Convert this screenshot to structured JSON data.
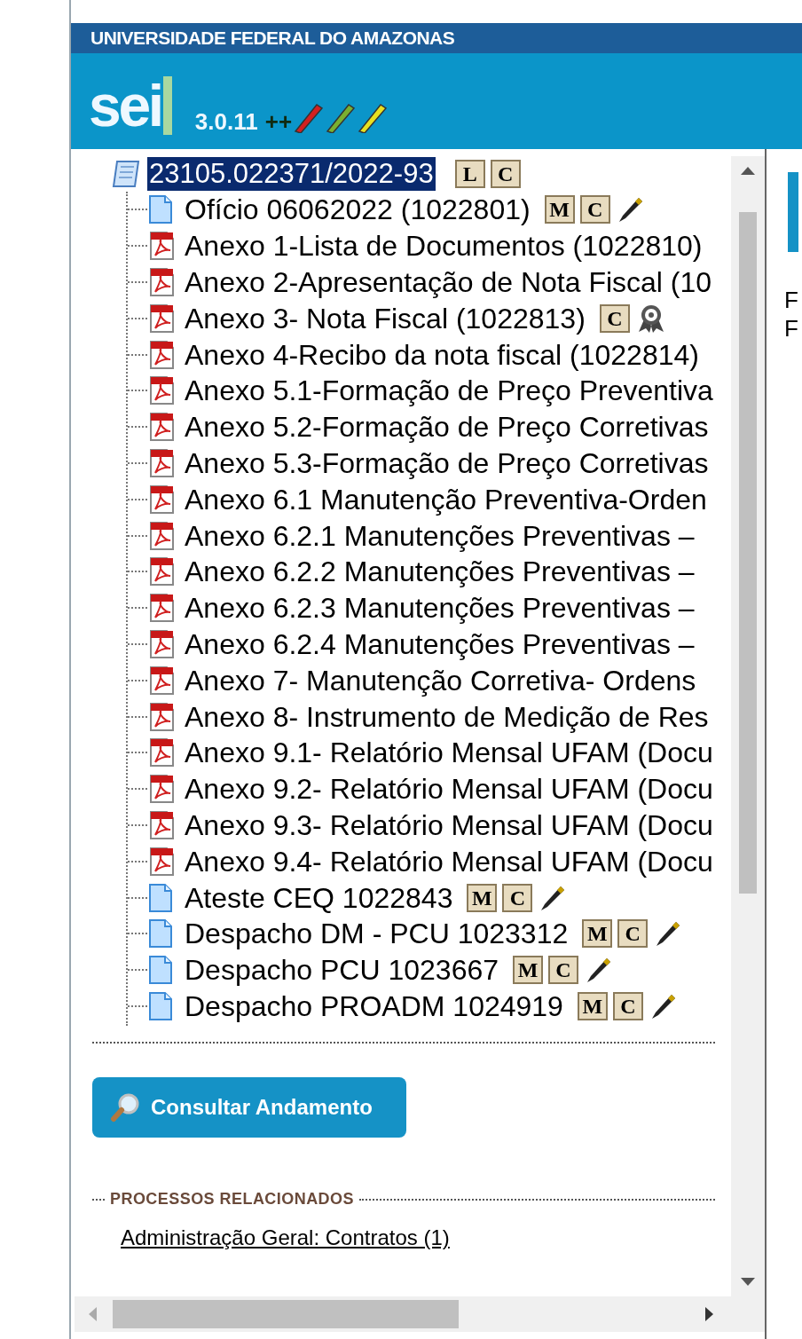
{
  "header": {
    "institution": "UNIVERSIDADE FEDERAL DO AMAZONAS",
    "logo": "sei",
    "version": "3.0.11",
    "version_suffix": "++"
  },
  "tree": {
    "root": {
      "label": "23105.022371/2022-93",
      "selected": true,
      "badges": [
        "L",
        "C"
      ]
    },
    "items": [
      {
        "kind": "doc",
        "label": "Ofício 06062022 (1022801)",
        "badges": [
          "M",
          "C"
        ],
        "pen": true
      },
      {
        "kind": "pdf",
        "label": "Anexo 1-Lista de Documentos (1022810)"
      },
      {
        "kind": "pdf",
        "label": "Anexo 2-Apresentação de Nota Fiscal (10"
      },
      {
        "kind": "pdf",
        "label": "Anexo 3- Nota Fiscal (1022813)",
        "badges": [
          "C"
        ],
        "seal": true
      },
      {
        "kind": "pdf",
        "label": "Anexo 4-Recibo da nota fiscal (1022814)"
      },
      {
        "kind": "pdf",
        "label": "Anexo 5.1-Formação de Preço Preventiva"
      },
      {
        "kind": "pdf",
        "label": "Anexo 5.2-Formação de Preço Corretivas"
      },
      {
        "kind": "pdf",
        "label": "Anexo 5.3-Formação de Preço Corretivas"
      },
      {
        "kind": "pdf",
        "label": "Anexo 6.1 Manutenção Preventiva-Orden"
      },
      {
        "kind": "pdf",
        "label": "Anexo 6.2.1 Manutenções Preventivas –"
      },
      {
        "kind": "pdf",
        "label": "Anexo 6.2.2 Manutenções Preventivas –"
      },
      {
        "kind": "pdf",
        "label": "Anexo 6.2.3 Manutenções Preventivas –"
      },
      {
        "kind": "pdf",
        "label": "Anexo 6.2.4 Manutenções Preventivas –"
      },
      {
        "kind": "pdf",
        "label": "Anexo 7- Manutenção Corretiva- Ordens"
      },
      {
        "kind": "pdf",
        "label": "Anexo 8- Instrumento de Medição de Res"
      },
      {
        "kind": "pdf",
        "label": "Anexo 9.1- Relatório Mensal UFAM (Docu"
      },
      {
        "kind": "pdf",
        "label": "Anexo 9.2- Relatório Mensal UFAM (Docu"
      },
      {
        "kind": "pdf",
        "label": "Anexo 9.3- Relatório Mensal UFAM (Docu"
      },
      {
        "kind": "pdf",
        "label": "Anexo 9.4- Relatório Mensal UFAM (Docu"
      },
      {
        "kind": "doc",
        "label": "Ateste CEQ 1022843",
        "badges": [
          "M",
          "C"
        ],
        "pen": true
      },
      {
        "kind": "doc",
        "label": "Despacho DM - PCU 1023312",
        "badges": [
          "M",
          "C"
        ],
        "pen": true
      },
      {
        "kind": "doc",
        "label": "Despacho PCU 1023667",
        "badges": [
          "M",
          "C"
        ],
        "pen": true
      },
      {
        "kind": "doc",
        "label": "Despacho PROADM 1024919",
        "badges": [
          "M",
          "C"
        ],
        "pen": true
      }
    ]
  },
  "consult_button": "Consultar Andamento",
  "related": {
    "heading": "PROCESSOS RELACIONADOS",
    "links": [
      "Administração Geral: Contratos (1)"
    ]
  },
  "right_panel": {
    "lines": [
      "F",
      "F"
    ]
  }
}
